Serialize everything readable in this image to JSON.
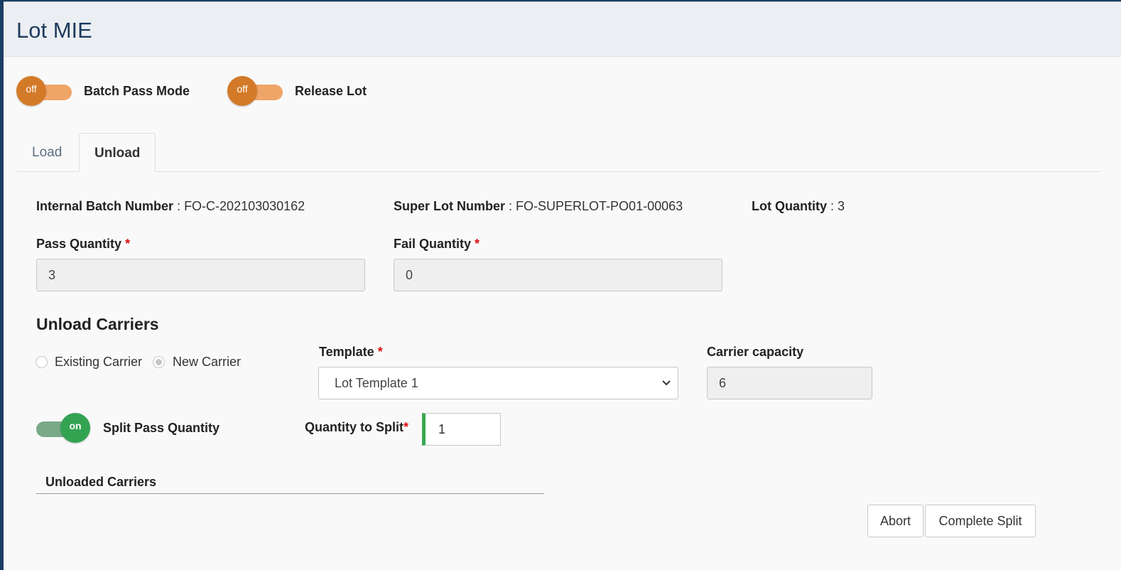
{
  "header": {
    "title": "Lot MIE"
  },
  "toggles": {
    "batch_pass_mode": {
      "state": "off",
      "label": "Batch Pass Mode"
    },
    "release_lot": {
      "state": "off",
      "label": "Release Lot"
    }
  },
  "tabs": [
    {
      "label": "Load",
      "active": false
    },
    {
      "label": "Unload",
      "active": true
    }
  ],
  "info": {
    "internal_batch": {
      "label": "Internal Batch Number",
      "value": "FO-C-202103030162"
    },
    "super_lot": {
      "label": "Super Lot Number",
      "value": "FO-SUPERLOT-PO01-00063"
    },
    "lot_quantity": {
      "label": "Lot Quantity",
      "value": "3"
    },
    "separator": " : "
  },
  "fields": {
    "pass_quantity": {
      "label": "Pass Quantity",
      "value": "3"
    },
    "fail_quantity": {
      "label": "Fail Quantity",
      "value": "0"
    },
    "required_mark": "*"
  },
  "unload_carriers": {
    "title": "Unload Carriers",
    "radios": [
      {
        "label": "Existing Carrier",
        "checked": false
      },
      {
        "label": "New Carrier",
        "checked": true
      }
    ],
    "template": {
      "label": "Template",
      "selected": "Lot Template 1"
    },
    "carrier_capacity": {
      "label": "Carrier capacity",
      "value": "6"
    },
    "split_toggle": {
      "state": "on",
      "label": "Split Pass Quantity"
    },
    "quantity_to_split": {
      "label": "Quantity to Split",
      "value": "1"
    }
  },
  "unloaded_carriers": {
    "title": "Unloaded Carriers"
  },
  "actions": {
    "abort": "Abort",
    "complete_split": "Complete Split"
  },
  "colors": {
    "header_bg": "#ebeef2",
    "title_blue": "#1d3b5e",
    "toggle_off_knob": "#d37a28",
    "toggle_off_track": "#f0a568",
    "toggle_on_knob": "#33a352",
    "toggle_on_track": "#7aa98a",
    "required": "#dd1111"
  }
}
